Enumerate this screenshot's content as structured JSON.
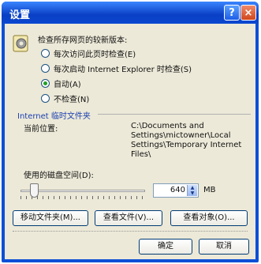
{
  "window": {
    "title": "设置",
    "help_label": "?",
    "close_label": "×"
  },
  "group": {
    "label": "检查所存网页的较新版本:",
    "options": [
      {
        "label": "每次访问此页时检查(E)",
        "checked": false
      },
      {
        "label": "每次启动 Internet Explorer 时检查(S)",
        "checked": false
      },
      {
        "label": "自动(A)",
        "checked": true
      },
      {
        "label": "不检查(N)",
        "checked": false
      }
    ]
  },
  "temp_folder": {
    "section_title": "Internet 临时文件夹",
    "location_label": "当前位置:",
    "location_value": "C:\\Documents and Settings\\mictowner\\Local Settings\\Temporary Internet Files\\"
  },
  "disk": {
    "label": "使用的磁盘空间(D):",
    "value": "640",
    "unit": "MB",
    "slider_fraction": 0.08
  },
  "buttons": {
    "move_folder": "移动文件夹(M)...",
    "view_files": "查看文件(V)...",
    "view_objects": "查看对象(O)...",
    "ok": "确定",
    "cancel": "取消"
  },
  "icons": {
    "group_icon": "gear-icon",
    "spin_up": "arrow-up-icon",
    "spin_down": "arrow-down-icon"
  },
  "colors": {
    "titlebar": "#0a47d0",
    "dialog_bg": "#ece9d8",
    "accent": "#1b3fb0"
  }
}
